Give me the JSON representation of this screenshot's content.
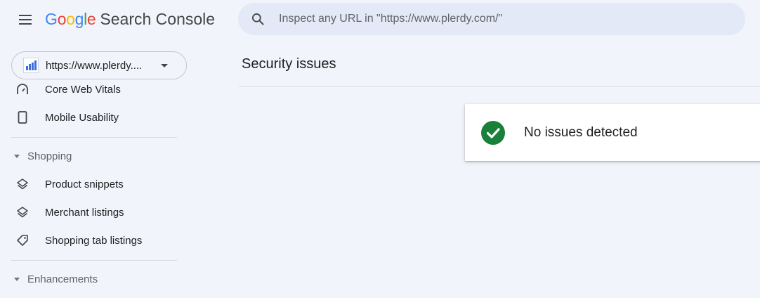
{
  "header": {
    "logo_letters": [
      {
        "ch": "G",
        "color": "#4285F4"
      },
      {
        "ch": "o",
        "color": "#EA4335"
      },
      {
        "ch": "o",
        "color": "#FBBC05"
      },
      {
        "ch": "g",
        "color": "#4285F4"
      },
      {
        "ch": "l",
        "color": "#34A853"
      },
      {
        "ch": "e",
        "color": "#EA4335"
      }
    ],
    "product_name": "Search Console",
    "search_placeholder": "Inspect any URL in \"https://www.plerdy.com/\""
  },
  "property": {
    "label": "https://www.plerdy...."
  },
  "sidebar": {
    "items": [
      {
        "label": "Core Web Vitals",
        "icon": "gauge-icon"
      },
      {
        "label": "Mobile Usability",
        "icon": "smartphone-icon"
      }
    ],
    "shopping": {
      "label": "Shopping",
      "items": [
        {
          "label": "Product snippets",
          "icon": "layers-icon"
        },
        {
          "label": "Merchant listings",
          "icon": "layers-icon"
        },
        {
          "label": "Shopping tab listings",
          "icon": "tag-icon"
        }
      ]
    },
    "enhancements": {
      "label": "Enhancements"
    }
  },
  "main": {
    "title": "Security issues",
    "status_message": "No issues detected",
    "status_color": "#188038"
  }
}
